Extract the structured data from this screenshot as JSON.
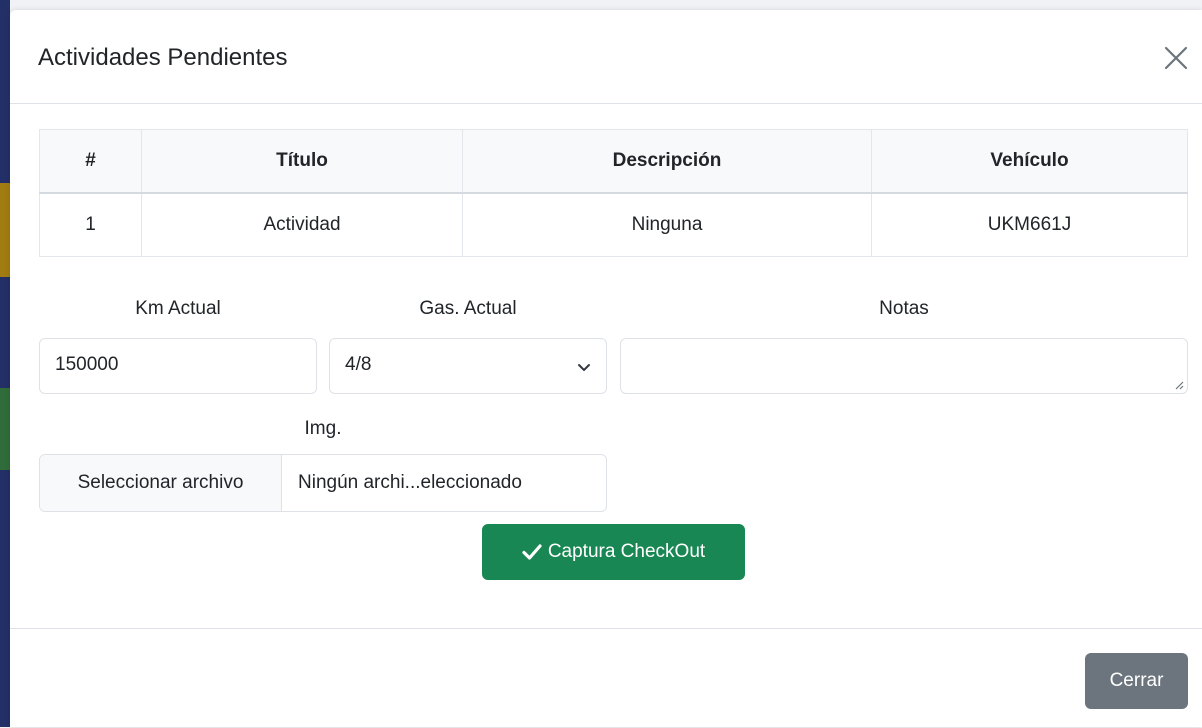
{
  "modal": {
    "title": "Actividades Pendientes"
  },
  "table": {
    "headers": [
      "#",
      "Título",
      "Descripción",
      "Vehículo"
    ],
    "rows": [
      [
        "1",
        "Actividad",
        "Ninguna",
        "UKM661J"
      ]
    ]
  },
  "form": {
    "km_label": "Km Actual",
    "km_value": "150000",
    "gas_label": "Gas. Actual",
    "gas_value": "4/8",
    "notes_label": "Notas",
    "notes_value": "",
    "img_label": "Img.",
    "file_button_label": "Seleccionar archivo",
    "file_status": "Ningún archi...eleccionado"
  },
  "actions": {
    "checkout_label": "Captura CheckOut",
    "close_label": "Cerrar"
  },
  "colors": {
    "success": "#198754",
    "secondary": "#6c757d"
  },
  "icons": {
    "close": "close-icon",
    "checkout": "checkmark-icon",
    "select": "chevron-down-icon"
  }
}
